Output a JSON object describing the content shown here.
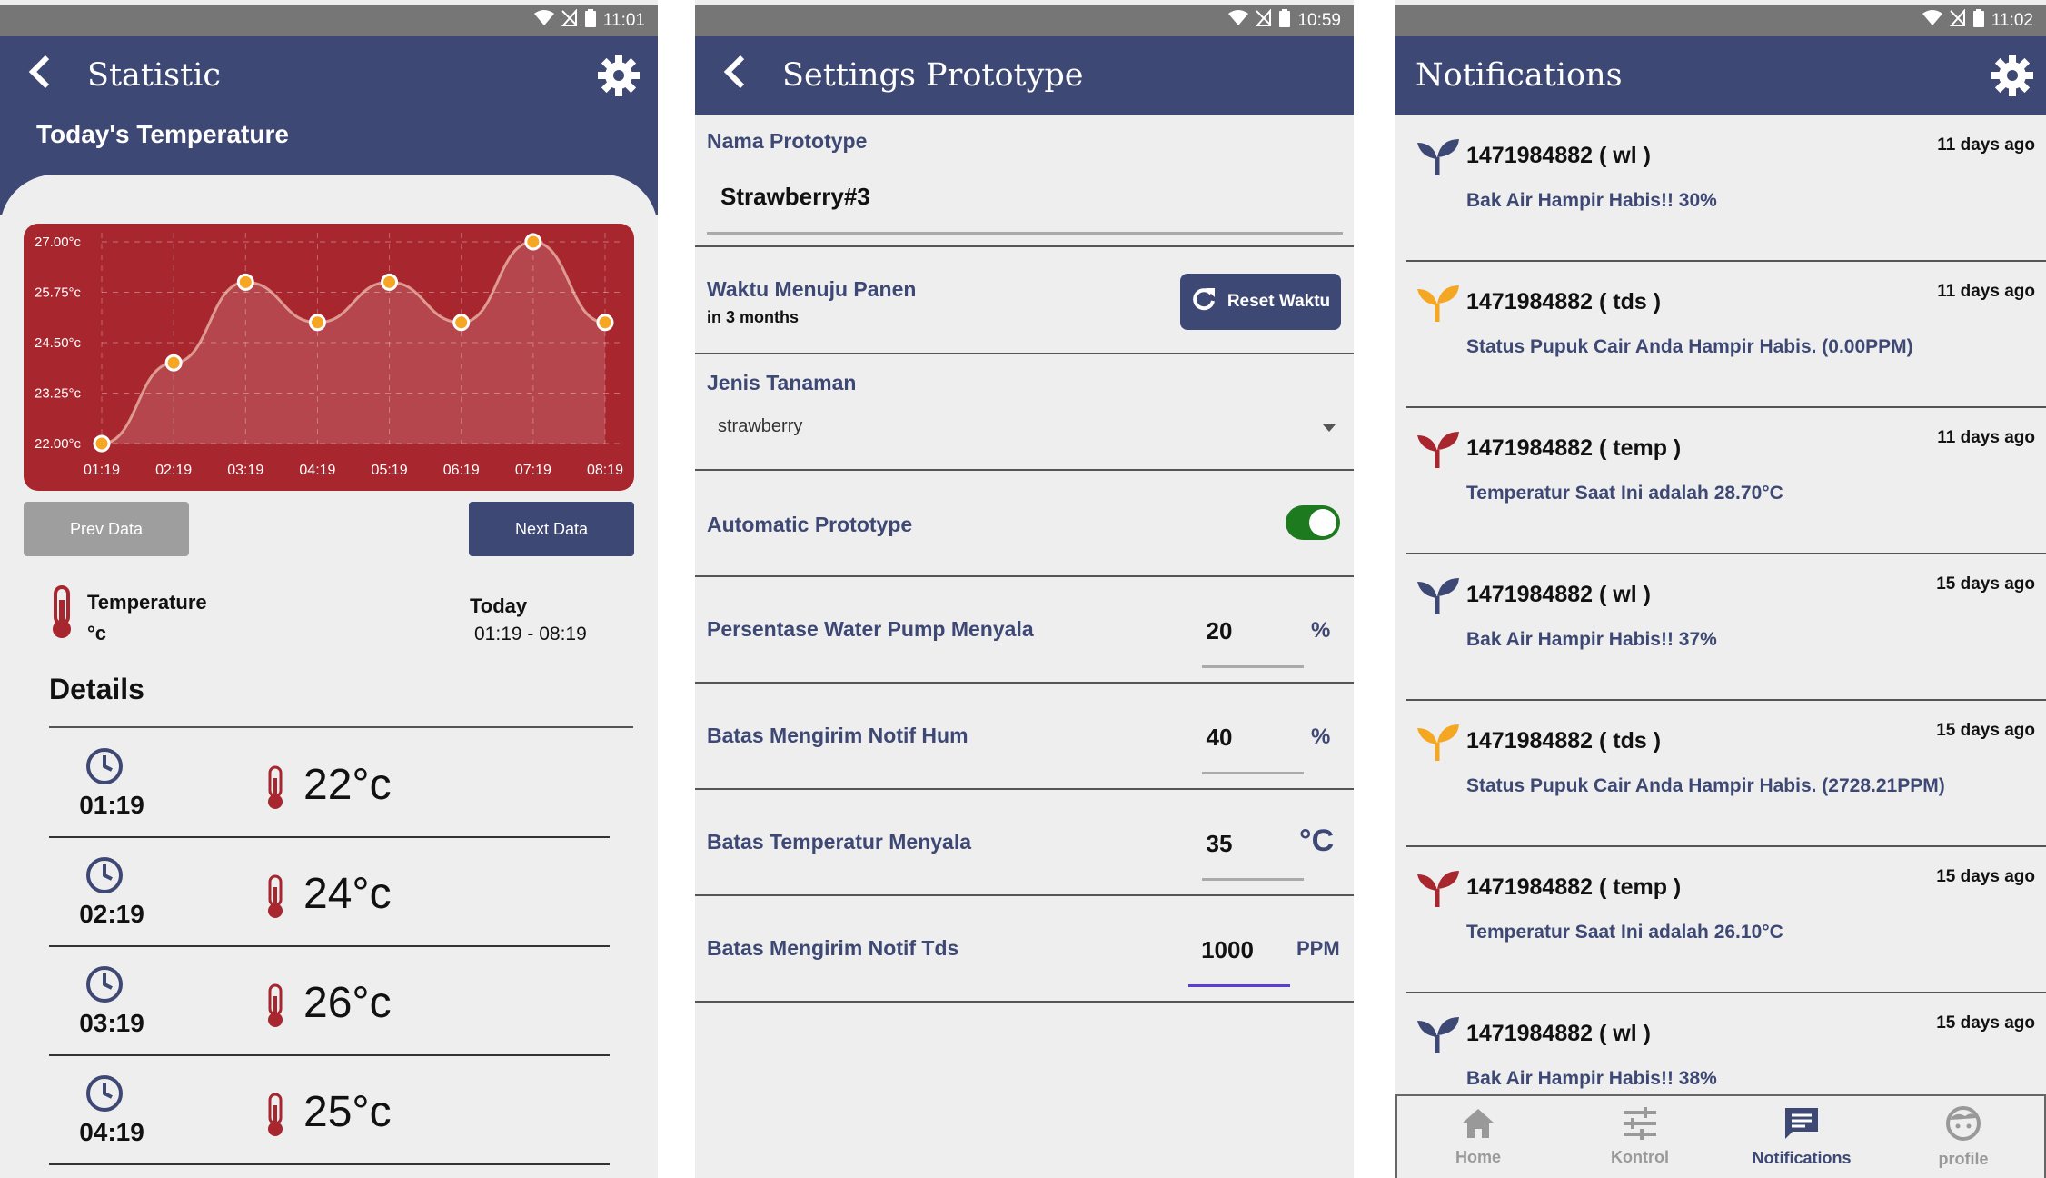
{
  "statistic": {
    "status_time": "11:01",
    "title": "Statistic",
    "subtitle": "Today's Temperature",
    "chart_data": {
      "type": "line",
      "x": [
        "01:19",
        "02:19",
        "03:19",
        "04:19",
        "05:19",
        "06:19",
        "07:19",
        "08:19"
      ],
      "series": [
        {
          "values": [
            22,
            24,
            26,
            25,
            26,
            25,
            27,
            25
          ]
        }
      ],
      "ytick_labels": [
        "27.00°c",
        "25.75°c",
        "24.50°c",
        "23.25°c",
        "22.00°c"
      ],
      "ylim": [
        22,
        27
      ],
      "grid": true
    },
    "prev_label": "Prev Data",
    "next_label": "Next Data",
    "info_label": "Temperature",
    "info_unit": "°c",
    "today_label": "Today",
    "today_range": "01:19 - 08:19",
    "details_title": "Details",
    "details": [
      {
        "time": "01:19",
        "temp": "22°c"
      },
      {
        "time": "02:19",
        "temp": "24°c"
      },
      {
        "time": "03:19",
        "temp": "26°c"
      },
      {
        "time": "04:19",
        "temp": "25°c"
      }
    ]
  },
  "settings": {
    "status_time": "10:59",
    "title": "Settings Prototype",
    "nama_label": "Nama Prototype",
    "nama_value": "Strawberry#3",
    "waktu_label": "Waktu Menuju Panen",
    "waktu_value": "in 3 months",
    "reset_label": "Reset Waktu",
    "jenis_label": "Jenis Tanaman",
    "jenis_value": "strawberry",
    "auto_label": "Automatic Prototype",
    "auto_on": true,
    "fields": [
      {
        "label": "Persentase Water Pump Menyala",
        "value": "20",
        "unit": "%"
      },
      {
        "label": "Batas Mengirim Notif Hum",
        "value": "40",
        "unit": "%"
      },
      {
        "label": "Batas Temperatur Menyala",
        "value": "35",
        "unit": "°C"
      },
      {
        "label": "Batas Mengirim Notif Tds",
        "value": "1000",
        "unit": "PPM"
      }
    ]
  },
  "notifications": {
    "status_time": "11:02",
    "title": "Notifications",
    "items": [
      {
        "head": "1471984882 ( wl )",
        "ago": "11 days ago",
        "msg": "Bak Air Hampir Habis!! 30%",
        "color": "#3e4874"
      },
      {
        "head": "1471984882 ( tds )",
        "ago": "11 days ago",
        "msg": "Status Pupuk Cair Anda Hampir Habis. (0.00PPM)",
        "color": "#f5a623"
      },
      {
        "head": "1471984882 ( temp )",
        "ago": "11 days ago",
        "msg": "Temperatur Saat Ini adalah 28.70°C",
        "color": "#a8262e"
      },
      {
        "head": "1471984882 ( wl )",
        "ago": "15 days ago",
        "msg": "Bak Air Hampir Habis!! 37%",
        "color": "#3e4874"
      },
      {
        "head": "1471984882 ( tds )",
        "ago": "15 days ago",
        "msg": "Status Pupuk Cair Anda Hampir Habis. (2728.21PPM)",
        "color": "#f5a623"
      },
      {
        "head": "1471984882 ( temp )",
        "ago": "15 days ago",
        "msg": "Temperatur Saat Ini adalah 26.10°C",
        "color": "#a8262e"
      },
      {
        "head": "1471984882 ( wl )",
        "ago": "15 days ago",
        "msg": "Bak Air Hampir Habis!! 38%",
        "color": "#3e4874"
      }
    ],
    "nav": [
      "Home",
      "Kontrol",
      "Notifications",
      "profile"
    ]
  },
  "colors": {
    "primary": "#3e4874",
    "chart_bg": "#a8262e",
    "toggle_on": "#1e7a1e",
    "accent_orange": "#f5a623"
  }
}
